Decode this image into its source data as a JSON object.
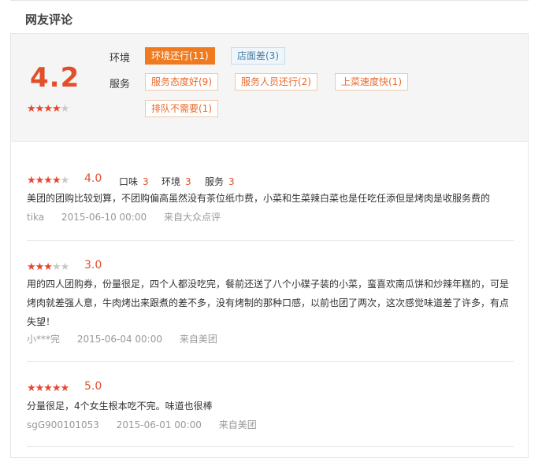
{
  "section_title": "网友评论",
  "summary": {
    "score": "4.2",
    "rating_stars": 4,
    "rows": [
      {
        "label": "环境",
        "tags": [
          {
            "text": "环境还行(11)",
            "style": "active"
          },
          {
            "text": "店面差(3)",
            "style": "neg"
          }
        ]
      },
      {
        "label": "服务",
        "tags": [
          {
            "text": "服务态度好(9)",
            "style": "pos"
          },
          {
            "text": "服务人员还行(2)",
            "style": "pos"
          },
          {
            "text": "上菜速度快(1)",
            "style": "pos"
          }
        ]
      },
      {
        "label": "",
        "tags": [
          {
            "text": "排队不需要(1)",
            "style": "pos"
          }
        ]
      }
    ]
  },
  "reviews": [
    {
      "stars": 4,
      "score": "4.0",
      "sub_scores": [
        {
          "label": "口味",
          "value": "3"
        },
        {
          "label": "环境",
          "value": "3"
        },
        {
          "label": "服务",
          "value": "3"
        }
      ],
      "text": "美团的团购比较划算，不团购偏高虽然没有茶位纸巾费，小菜和生菜辣白菜也是任吃任添但是烤肉是收服务费的",
      "user": "tika",
      "date": "2015-06-10 00:00",
      "source": "来自大众点评"
    },
    {
      "stars": 3,
      "score": "3.0",
      "sub_scores": [],
      "text": "用的四人团购券，份量很足，四个人都没吃完，餐前还送了八个小碟子装的小菜，蛮喜欢南瓜饼和炒辣年糕的，可是烤肉就差强人意，牛肉烤出来跟煮的差不多，没有烤制的那种口感，以前也团了两次，这次感觉味道差了许多，有点失望！",
      "user": "小***完",
      "date": "2015-06-04 00:00",
      "source": "来自美团"
    },
    {
      "stars": 5,
      "score": "5.0",
      "sub_scores": [],
      "text": "分量很足，4个女生根本吃不完。味道也很棒",
      "user": "sgG900101053",
      "date": "2015-06-01 00:00",
      "source": "来自美团"
    }
  ]
}
